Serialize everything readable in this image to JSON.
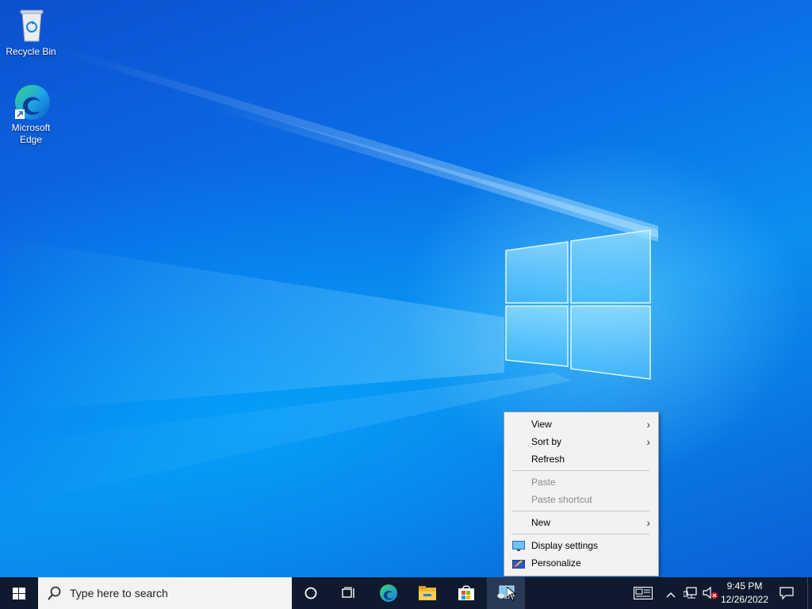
{
  "desktop": {
    "icons": [
      {
        "label": "Recycle Bin",
        "icon": "recycle-bin-icon"
      },
      {
        "label": "Microsoft Edge",
        "icon": "edge-icon"
      }
    ]
  },
  "context_menu": {
    "items": [
      {
        "label": "View",
        "submenu": true,
        "enabled": true
      },
      {
        "label": "Sort by",
        "submenu": true,
        "enabled": true
      },
      {
        "label": "Refresh",
        "submenu": false,
        "enabled": true
      },
      {
        "label": "Paste",
        "submenu": false,
        "enabled": false
      },
      {
        "label": "Paste shortcut",
        "submenu": false,
        "enabled": false
      },
      {
        "label": "New",
        "submenu": true,
        "enabled": true
      },
      {
        "label": "Display settings",
        "submenu": false,
        "enabled": true,
        "icon": "display-settings-icon"
      },
      {
        "label": "Personalize",
        "submenu": false,
        "enabled": true,
        "icon": "personalize-icon"
      }
    ]
  },
  "taskbar": {
    "search_placeholder": "Type here to search",
    "clock_time": "9:45 PM",
    "clock_date": "12/26/2022"
  },
  "colors": {
    "taskbar_bg": "#101a2e",
    "desktop_accent": "#0a6fe6",
    "menu_bg": "#f2f2f2"
  }
}
